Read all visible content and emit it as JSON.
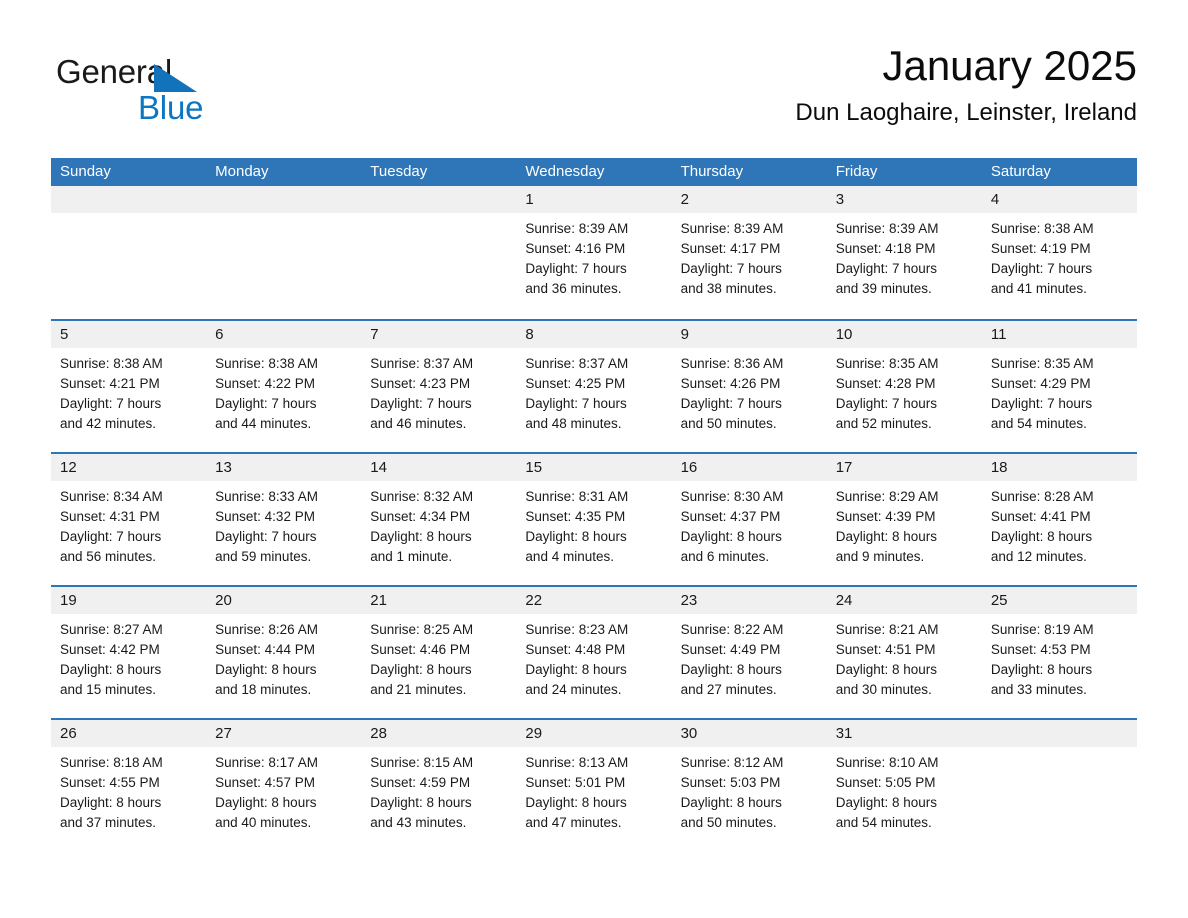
{
  "brand": {
    "word_general": "General",
    "word_blue": "Blue",
    "triangle_color": "#1273bb",
    "blue_color": "#0d76c4"
  },
  "header": {
    "month_title": "January 2025",
    "location": "Dun Laoghaire, Leinster, Ireland"
  },
  "theme": {
    "header_bg": "#2e76b8",
    "header_text": "#ffffff",
    "daynum_band_bg": "#f0f0f0",
    "row_divider": "#2e76b8",
    "page_bg": "#ffffff",
    "body_text": "#1a1a1a"
  },
  "weekdays": [
    "Sunday",
    "Monday",
    "Tuesday",
    "Wednesday",
    "Thursday",
    "Friday",
    "Saturday"
  ],
  "weeks": [
    [
      {
        "day": "",
        "lines": []
      },
      {
        "day": "",
        "lines": []
      },
      {
        "day": "",
        "lines": []
      },
      {
        "day": "1",
        "lines": [
          "Sunrise: 8:39 AM",
          "Sunset: 4:16 PM",
          "Daylight: 7 hours",
          "and 36 minutes."
        ]
      },
      {
        "day": "2",
        "lines": [
          "Sunrise: 8:39 AM",
          "Sunset: 4:17 PM",
          "Daylight: 7 hours",
          "and 38 minutes."
        ]
      },
      {
        "day": "3",
        "lines": [
          "Sunrise: 8:39 AM",
          "Sunset: 4:18 PM",
          "Daylight: 7 hours",
          "and 39 minutes."
        ]
      },
      {
        "day": "4",
        "lines": [
          "Sunrise: 8:38 AM",
          "Sunset: 4:19 PM",
          "Daylight: 7 hours",
          "and 41 minutes."
        ]
      }
    ],
    [
      {
        "day": "5",
        "lines": [
          "Sunrise: 8:38 AM",
          "Sunset: 4:21 PM",
          "Daylight: 7 hours",
          "and 42 minutes."
        ]
      },
      {
        "day": "6",
        "lines": [
          "Sunrise: 8:38 AM",
          "Sunset: 4:22 PM",
          "Daylight: 7 hours",
          "and 44 minutes."
        ]
      },
      {
        "day": "7",
        "lines": [
          "Sunrise: 8:37 AM",
          "Sunset: 4:23 PM",
          "Daylight: 7 hours",
          "and 46 minutes."
        ]
      },
      {
        "day": "8",
        "lines": [
          "Sunrise: 8:37 AM",
          "Sunset: 4:25 PM",
          "Daylight: 7 hours",
          "and 48 minutes."
        ]
      },
      {
        "day": "9",
        "lines": [
          "Sunrise: 8:36 AM",
          "Sunset: 4:26 PM",
          "Daylight: 7 hours",
          "and 50 minutes."
        ]
      },
      {
        "day": "10",
        "lines": [
          "Sunrise: 8:35 AM",
          "Sunset: 4:28 PM",
          "Daylight: 7 hours",
          "and 52 minutes."
        ]
      },
      {
        "day": "11",
        "lines": [
          "Sunrise: 8:35 AM",
          "Sunset: 4:29 PM",
          "Daylight: 7 hours",
          "and 54 minutes."
        ]
      }
    ],
    [
      {
        "day": "12",
        "lines": [
          "Sunrise: 8:34 AM",
          "Sunset: 4:31 PM",
          "Daylight: 7 hours",
          "and 56 minutes."
        ]
      },
      {
        "day": "13",
        "lines": [
          "Sunrise: 8:33 AM",
          "Sunset: 4:32 PM",
          "Daylight: 7 hours",
          "and 59 minutes."
        ]
      },
      {
        "day": "14",
        "lines": [
          "Sunrise: 8:32 AM",
          "Sunset: 4:34 PM",
          "Daylight: 8 hours",
          "and 1 minute."
        ]
      },
      {
        "day": "15",
        "lines": [
          "Sunrise: 8:31 AM",
          "Sunset: 4:35 PM",
          "Daylight: 8 hours",
          "and 4 minutes."
        ]
      },
      {
        "day": "16",
        "lines": [
          "Sunrise: 8:30 AM",
          "Sunset: 4:37 PM",
          "Daylight: 8 hours",
          "and 6 minutes."
        ]
      },
      {
        "day": "17",
        "lines": [
          "Sunrise: 8:29 AM",
          "Sunset: 4:39 PM",
          "Daylight: 8 hours",
          "and 9 minutes."
        ]
      },
      {
        "day": "18",
        "lines": [
          "Sunrise: 8:28 AM",
          "Sunset: 4:41 PM",
          "Daylight: 8 hours",
          "and 12 minutes."
        ]
      }
    ],
    [
      {
        "day": "19",
        "lines": [
          "Sunrise: 8:27 AM",
          "Sunset: 4:42 PM",
          "Daylight: 8 hours",
          "and 15 minutes."
        ]
      },
      {
        "day": "20",
        "lines": [
          "Sunrise: 8:26 AM",
          "Sunset: 4:44 PM",
          "Daylight: 8 hours",
          "and 18 minutes."
        ]
      },
      {
        "day": "21",
        "lines": [
          "Sunrise: 8:25 AM",
          "Sunset: 4:46 PM",
          "Daylight: 8 hours",
          "and 21 minutes."
        ]
      },
      {
        "day": "22",
        "lines": [
          "Sunrise: 8:23 AM",
          "Sunset: 4:48 PM",
          "Daylight: 8 hours",
          "and 24 minutes."
        ]
      },
      {
        "day": "23",
        "lines": [
          "Sunrise: 8:22 AM",
          "Sunset: 4:49 PM",
          "Daylight: 8 hours",
          "and 27 minutes."
        ]
      },
      {
        "day": "24",
        "lines": [
          "Sunrise: 8:21 AM",
          "Sunset: 4:51 PM",
          "Daylight: 8 hours",
          "and 30 minutes."
        ]
      },
      {
        "day": "25",
        "lines": [
          "Sunrise: 8:19 AM",
          "Sunset: 4:53 PM",
          "Daylight: 8 hours",
          "and 33 minutes."
        ]
      }
    ],
    [
      {
        "day": "26",
        "lines": [
          "Sunrise: 8:18 AM",
          "Sunset: 4:55 PM",
          "Daylight: 8 hours",
          "and 37 minutes."
        ]
      },
      {
        "day": "27",
        "lines": [
          "Sunrise: 8:17 AM",
          "Sunset: 4:57 PM",
          "Daylight: 8 hours",
          "and 40 minutes."
        ]
      },
      {
        "day": "28",
        "lines": [
          "Sunrise: 8:15 AM",
          "Sunset: 4:59 PM",
          "Daylight: 8 hours",
          "and 43 minutes."
        ]
      },
      {
        "day": "29",
        "lines": [
          "Sunrise: 8:13 AM",
          "Sunset: 5:01 PM",
          "Daylight: 8 hours",
          "and 47 minutes."
        ]
      },
      {
        "day": "30",
        "lines": [
          "Sunrise: 8:12 AM",
          "Sunset: 5:03 PM",
          "Daylight: 8 hours",
          "and 50 minutes."
        ]
      },
      {
        "day": "31",
        "lines": [
          "Sunrise: 8:10 AM",
          "Sunset: 5:05 PM",
          "Daylight: 8 hours",
          "and 54 minutes."
        ]
      },
      {
        "day": "",
        "lines": []
      }
    ]
  ]
}
